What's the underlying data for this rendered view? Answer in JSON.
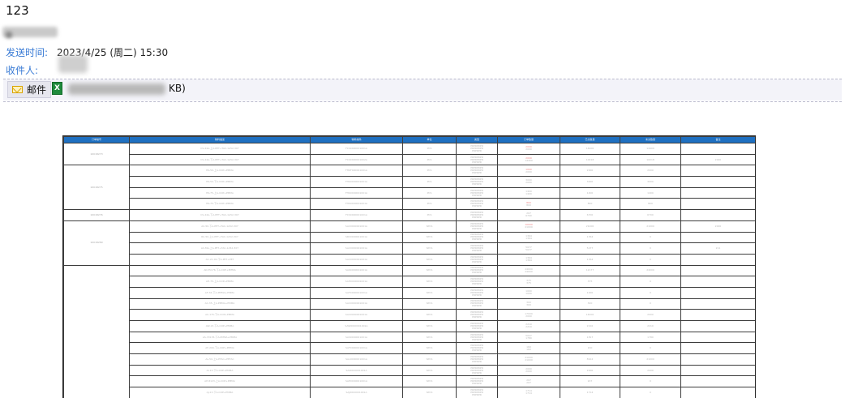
{
  "email": {
    "subject": "123",
    "sent_label": "发送时间:",
    "sent_value": "2023/4/25 (周二) 15:30",
    "recipient_label": "收件人:",
    "mail_button_label": "邮件",
    "attachment_size_suffix": "KB)"
  },
  "icons": {
    "mail_button": "envelope-icon",
    "attachment": "excel-file-icon"
  },
  "colors": {
    "label_blue": "#3a7bd5",
    "header_blue": "#1f70c1",
    "highlight_red": "#f08a8a"
  },
  "spreadsheet": {
    "headers": [
      "订单编号",
      "物料描述",
      "物料编码",
      "单位",
      "类型",
      "订单数量",
      "已交数量",
      "未交数量",
      "备注"
    ],
    "groups": [
      {
        "order": "10018273",
        "rows": [
          {
            "desc": "CS-24A-上A-PET+TAC-1A52-307",
            "code": "FCS0000001001A",
            "unit": "PCS",
            "qty": [
              "2000",
              "2000"
            ],
            "red": true,
            "delivered": "14400",
            "remaining": "14400",
            "note": ""
          },
          {
            "desc": "CS-24A-下A-PET+TAC-1A52-307",
            "code": "FCS0000001002A",
            "unit": "PCS",
            "qty": [
              "2000",
              "14400"
            ],
            "red": true,
            "delivered": "10018",
            "remaining": "10018",
            "note": "2000"
          }
        ]
      },
      {
        "order": "10018275",
        "rows": [
          {
            "desc": "HK-50-上A-COP+PMMA",
            "code": "FHKF000001001A",
            "unit": "PCS",
            "qty": [
              "1000",
              "2000"
            ],
            "red": true,
            "delivered": "2000",
            "remaining": "2000",
            "note": ""
          },
          {
            "desc": "HK-50-下A-COP+PMMA",
            "code": "FHK0000001001A",
            "unit": "PCS",
            "qty": [
              "3000",
              "2000"
            ],
            "red": false,
            "delivered": "3000",
            "remaining": "3000",
            "note": ""
          },
          {
            "desc": "HK-75-上A-COP+PMMA",
            "code": "FHK0000001001A",
            "unit": "PCS",
            "qty": [
              "1400",
              "1400"
            ],
            "red": false,
            "delivered": "1400",
            "remaining": "1400",
            "note": ""
          },
          {
            "desc": "HK-75-下A-COP+PMMA",
            "code": "FHK0000001001A",
            "unit": "PCS",
            "qty": [
              "800",
              "800"
            ],
            "red": true,
            "delivered": "800",
            "remaining": "800",
            "note": ""
          }
        ]
      },
      {
        "order": "10018276",
        "rows": [
          {
            "desc": "CS-24A-下A-PET+TAC-1A52-307",
            "code": "FCS0000001001A",
            "unit": "PCS",
            "qty": [
              "207",
              "6700"
            ],
            "red": false,
            "delivered": "6700",
            "remaining": "6700",
            "note": ""
          }
        ]
      },
      {
        "order": "10018289",
        "rows": [
          {
            "desc": "AC-50-下A-PET+TAC-1A52-307",
            "code": "SAC0000001001A",
            "unit": "SPCS",
            "qty": [
              "10000",
              "21000"
            ],
            "red": true,
            "delivered": "21000",
            "remaining": "21000",
            "note": "2000"
          },
          {
            "desc": "RC-50-上A-PET+TAC-1A52-307",
            "code": "SRC0000001001A",
            "unit": "SPCS",
            "qty": [
              "1364",
              "1364"
            ],
            "red": false,
            "delivered": "1364",
            "remaining": "0",
            "note": ""
          },
          {
            "desc": "AC-MA-上A-PET+TAC-1A52-307",
            "code": "SAC0000001001A",
            "unit": "SPCS",
            "qty": [
              "5077",
              "5077"
            ],
            "red": false,
            "delivered": "5077",
            "remaining": "0",
            "note": "211"
          },
          {
            "desc": "AC-21-00-下A-PET+PET",
            "code": "SAC0000001001A",
            "unit": "SPCS",
            "qty": [
              "1364",
              "1364"
            ],
            "red": false,
            "delivered": "1364",
            "remaining": "0",
            "note": ""
          }
        ]
      },
      {
        "order": "",
        "rows": [
          {
            "desc": "AK-55176-下A-COP+PMMA",
            "code": "SAK0000001001A",
            "unit": "SPCS",
            "qty": [
              "24000",
              "24000"
            ],
            "red": false,
            "delivered": "12177",
            "remaining": "24000",
            "note": ""
          },
          {
            "desc": "AH-75-上A-COP+PMMA",
            "code": "SAH0000001001A",
            "unit": "SPCS",
            "qty": [
              "375",
              "375"
            ],
            "red": false,
            "delivered": "375",
            "remaining": "0",
            "note": ""
          },
          {
            "desc": "AF-34-下A-PMMA+PMMA",
            "code": "SAF0000001001A",
            "unit": "SPCS",
            "qty": [
              "1000",
              "1000"
            ],
            "red": false,
            "delivered": "1000",
            "remaining": "0",
            "note": ""
          },
          {
            "desc": "AC-35-上A-PMMA+PMMA",
            "code": "SAC0000001001A",
            "unit": "SPCS",
            "qty": [
              "300",
              "300"
            ],
            "red": false,
            "delivered": "300",
            "remaining": "0",
            "note": ""
          },
          {
            "desc": "AC-175-下A-COP+PMMA",
            "code": "SAC0000001001A",
            "unit": "SPCS",
            "qty": [
              "17000",
              "2000"
            ],
            "red": false,
            "delivered": "14000",
            "remaining": "2000",
            "note": ""
          },
          {
            "desc": "AW-13-下A-COP+PMMA",
            "code": "SAW0000001001A",
            "unit": "SPCS",
            "qty": [
              "2210",
              "2210"
            ],
            "red": false,
            "delivered": "2210",
            "remaining": "2210",
            "note": ""
          },
          {
            "desc": "AS-33135-下A-PMMA+PMMA",
            "code": "SAS0000001001A",
            "unit": "SPCS",
            "qty": [
              "5027",
              "1780"
            ],
            "red": false,
            "delivered": "1817",
            "remaining": "1780",
            "note": ""
          },
          {
            "desc": "AF-200-下A-COP+PMMA",
            "code": "SAF0000001001A",
            "unit": "SPCS",
            "qty": [
              "160",
              "160"
            ],
            "red": false,
            "delivered": "160",
            "remaining": "0",
            "note": ""
          },
          {
            "desc": "AL-50-上A-PTAC+PETAC",
            "code": "SAL0000001001A",
            "unit": "SPCS",
            "qty": [
              "21000",
              "21000"
            ],
            "red": false,
            "delivered": "8912",
            "remaining": "21000",
            "note": ""
          },
          {
            "desc": "AI-13-下A-COP+PMMA",
            "code": "SAI0000001001A",
            "unit": "SPCS",
            "qty": [
              "2000",
              "2000"
            ],
            "red": false,
            "delivered": "2000",
            "remaining": "2000",
            "note": ""
          },
          {
            "desc": "AE-8123-上A-COP+PMMA",
            "code": "SAE0000001001A",
            "unit": "SPCS",
            "qty": [
              "207",
              "207"
            ],
            "red": false,
            "delivered": "207",
            "remaining": "0",
            "note": ""
          },
          {
            "desc": "AJ-13-下A-COP+PMMA",
            "code": "SAJ0000001001A",
            "unit": "SPCS",
            "qty": [
              "1714",
              "1714"
            ],
            "red": false,
            "delivered": "1714",
            "remaining": "0",
            "note": ""
          }
        ]
      }
    ]
  }
}
